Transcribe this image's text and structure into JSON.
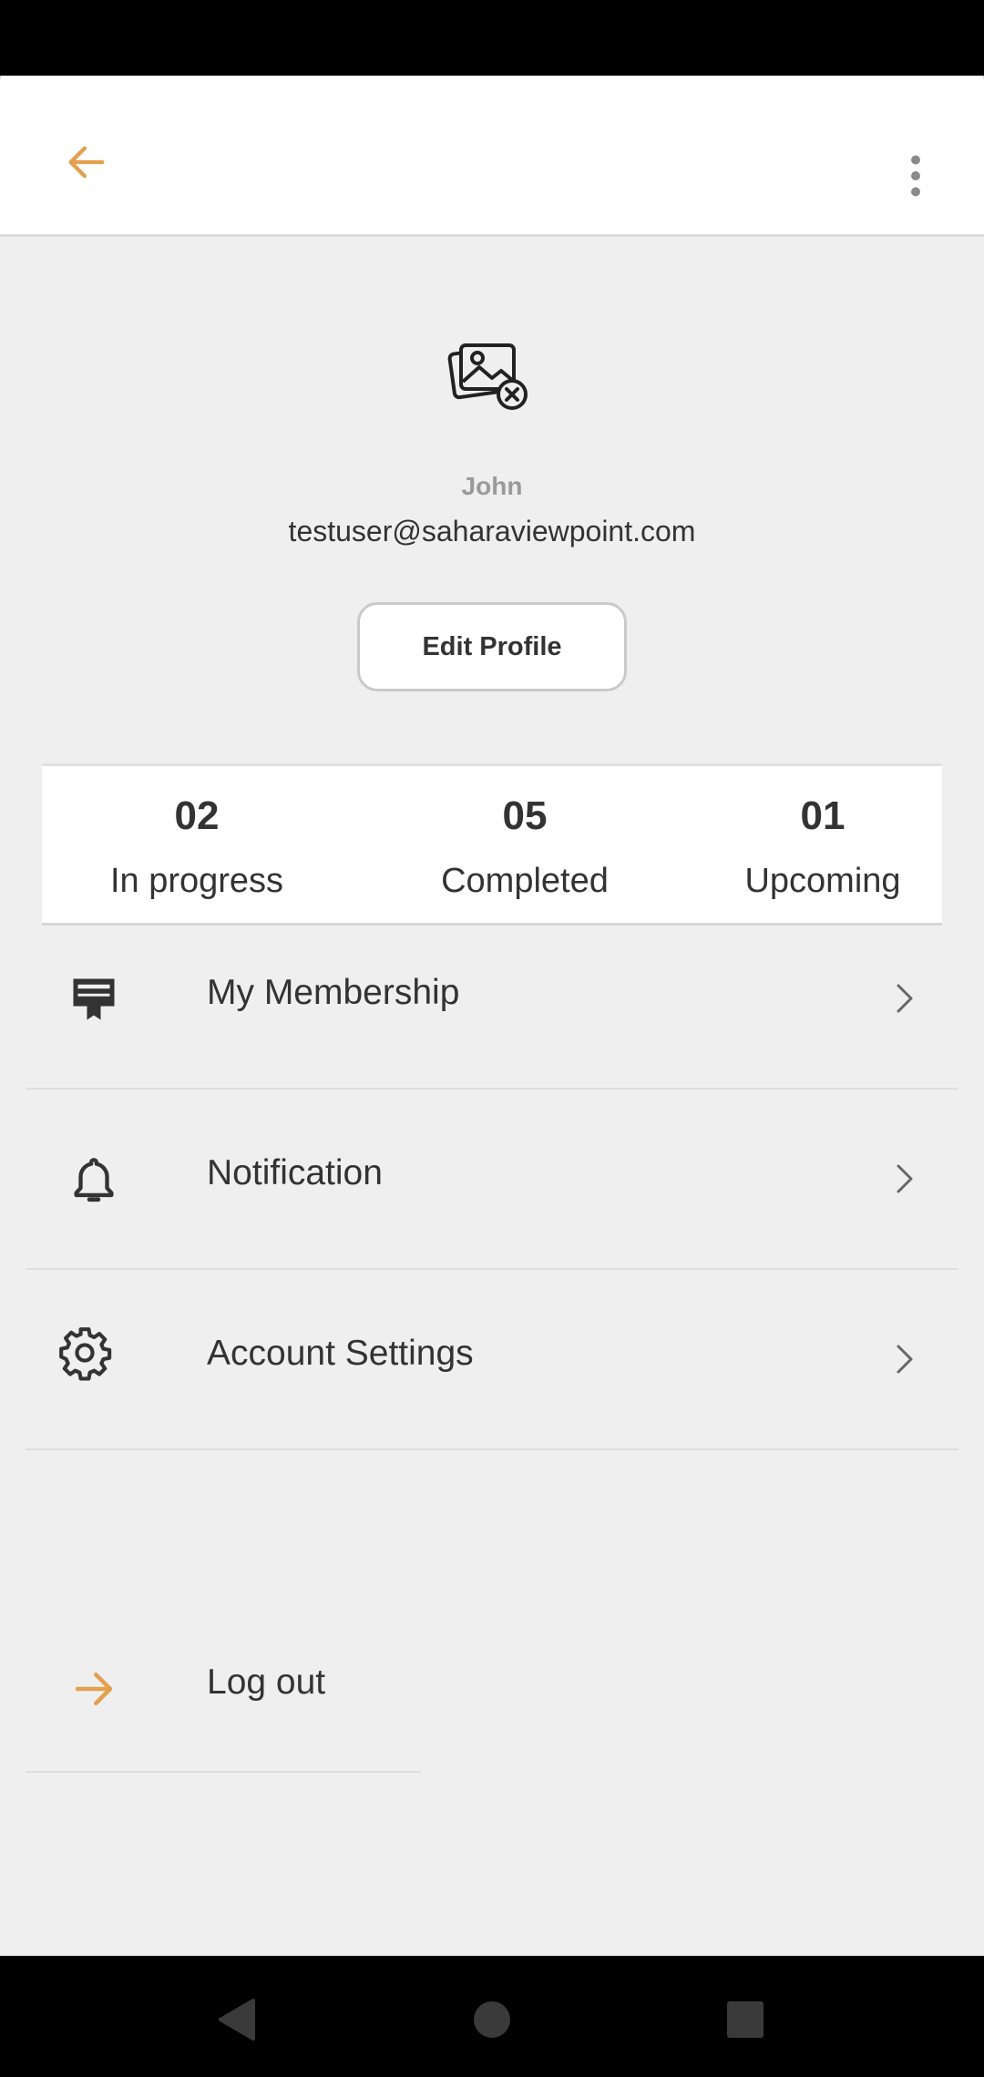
{
  "profile": {
    "name": "John",
    "email": "testuser@saharaviewpoint.com",
    "avatar_icon": "image-placeholder-icon"
  },
  "actions": {
    "edit_profile_label": "Edit Profile"
  },
  "stats": [
    {
      "value": "02",
      "label": "In progress"
    },
    {
      "value": "05",
      "label": "Completed"
    },
    {
      "value": "01",
      "label": "Upcoming"
    }
  ],
  "menu": [
    {
      "label": "My Membership",
      "icon": "membership-card-icon"
    },
    {
      "label": "Notification",
      "icon": "bell-icon"
    },
    {
      "label": "Account Settings",
      "icon": "gear-icon"
    }
  ],
  "logout": {
    "label": "Log out",
    "icon": "arrow-right-icon"
  },
  "colors": {
    "accent": "#E3A04E",
    "background": "#EFEFEF",
    "text": "#333333",
    "muted": "#9A9A9A"
  }
}
